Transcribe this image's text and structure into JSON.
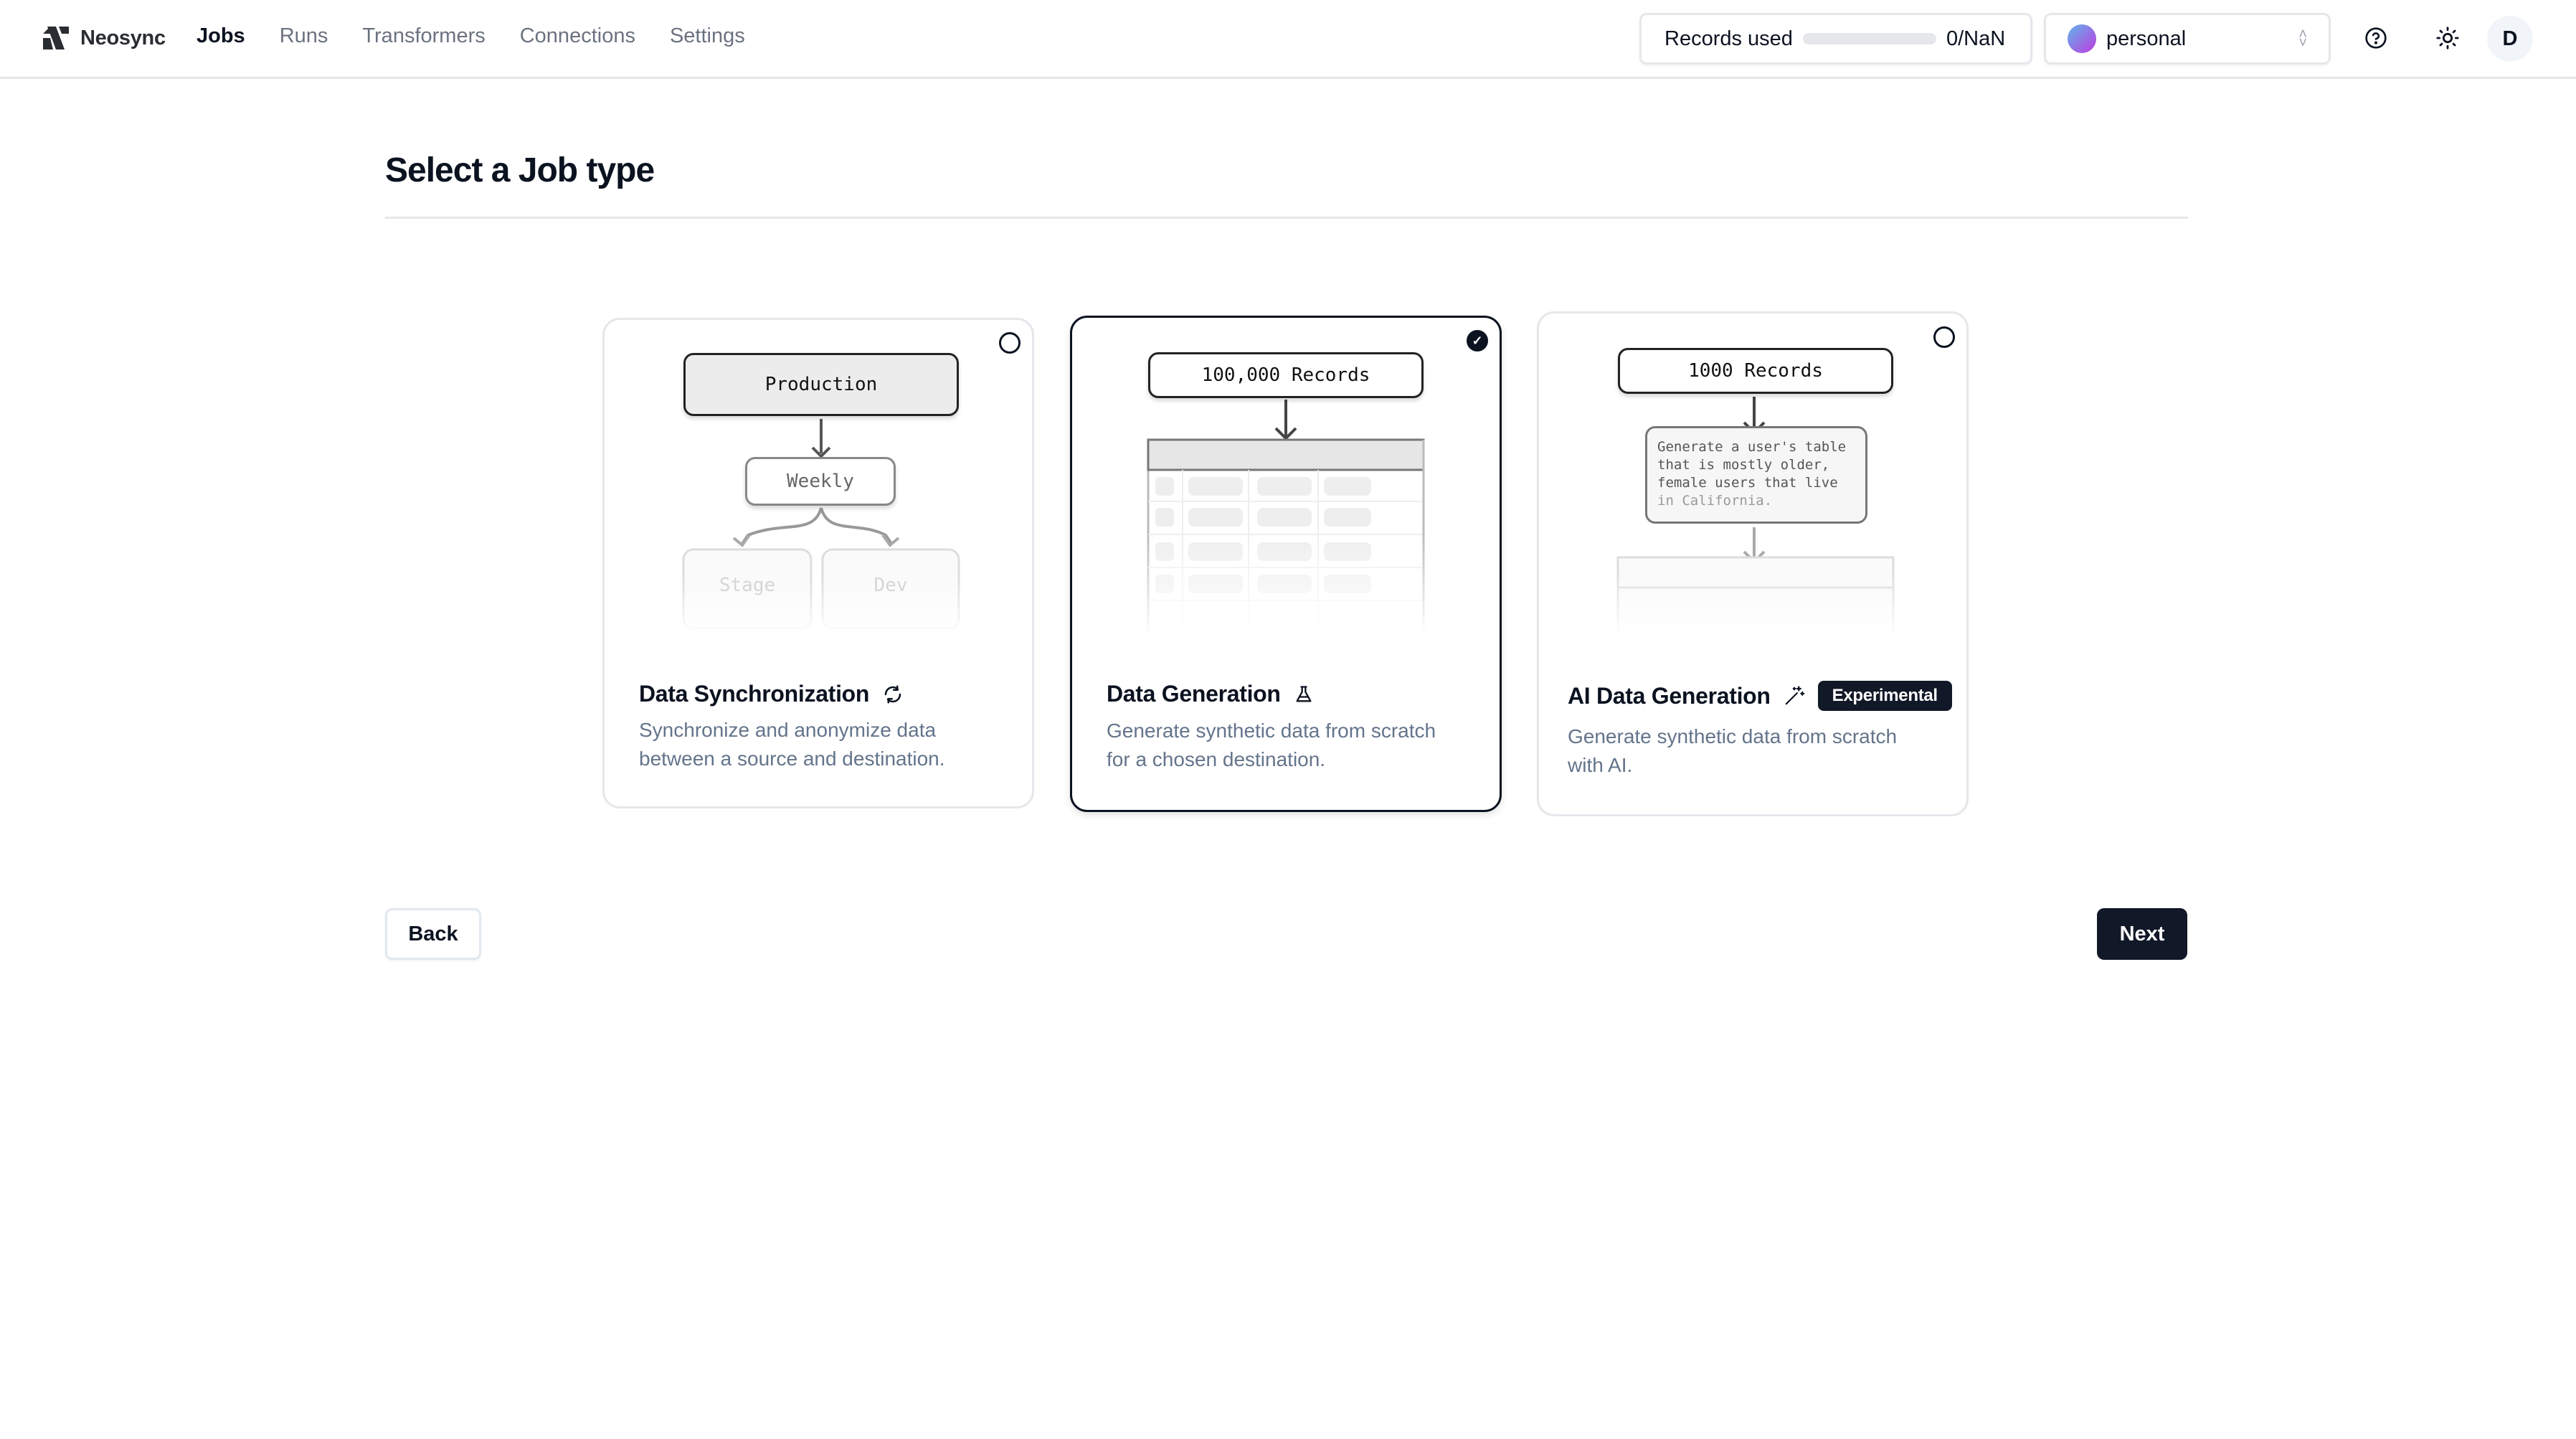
{
  "app": {
    "name": "Neosync"
  },
  "nav": [
    {
      "label": "Jobs",
      "active": true
    },
    {
      "label": "Runs",
      "active": false
    },
    {
      "label": "Transformers",
      "active": false
    },
    {
      "label": "Connections",
      "active": false
    },
    {
      "label": "Settings",
      "active": false
    }
  ],
  "header": {
    "records_label": "Records used",
    "records_value": "0/NaN",
    "records_progress": 0,
    "account_name": "personal",
    "help_icon": "help-circle-icon",
    "theme_icon": "sun-icon",
    "user_initial": "D"
  },
  "page": {
    "title": "Select a Job type"
  },
  "cards": [
    {
      "title": "Data Synchronization",
      "icon": "sync-icon",
      "description_line1": "Synchronize and anonymize data",
      "description_line2": "between a source and destination.",
      "selected": false,
      "diagram": {
        "source": "Production",
        "schedule": "Weekly",
        "targets": [
          "Stage",
          "Dev"
        ]
      }
    },
    {
      "title": "Data Generation",
      "icon": "flask-icon",
      "description_line1": "Generate synthetic data from scratch",
      "description_line2": "for a chosen destination.",
      "selected": true,
      "diagram": {
        "records": "100,000 Records"
      }
    },
    {
      "title": "AI Data Generation",
      "icon": "magic-wand-icon",
      "badge": "Experimental",
      "description_line1": "Generate synthetic data from scratch",
      "description_line2": "with AI.",
      "selected": false,
      "diagram": {
        "records": "1000 Records",
        "prompt_lines": [
          "Generate a user's table",
          "that is mostly older,",
          "female users that live",
          "in California."
        ]
      }
    }
  ],
  "actions": {
    "back": "Back",
    "next": "Next"
  }
}
